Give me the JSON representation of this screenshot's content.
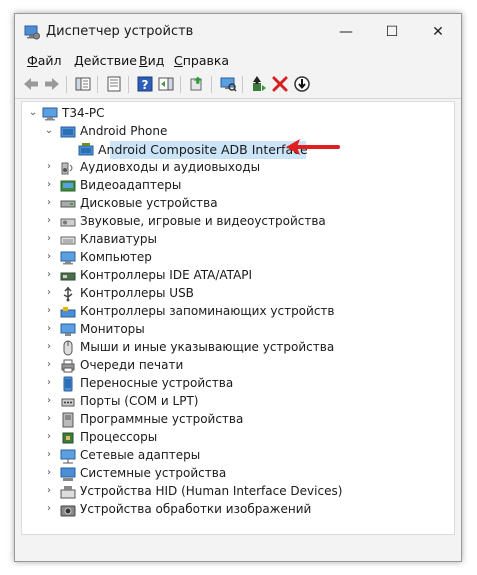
{
  "window": {
    "title": "Диспетчер устройств",
    "controls": {
      "minimize": "—",
      "maximize": "☐",
      "close": "✕"
    }
  },
  "menu": [
    "Файл",
    "Действие",
    "Вид",
    "Справка"
  ],
  "menu_access_keys": [
    "Ф",
    "Д",
    "В",
    "С"
  ],
  "toolbar": {
    "buttons": [
      "back-icon",
      "forward-icon",
      "show-hide-tree-icon",
      "properties-icon",
      "help-icon",
      "action-pane-icon",
      "update-driver-icon",
      "scan-hardware-icon",
      "enable-device-icon",
      "uninstall-icon",
      "disable-device-icon"
    ]
  },
  "tree": {
    "root": "T34-PC",
    "expanded_category": "Android Phone",
    "selected_device": "Android Composite ADB Interface",
    "categories": [
      "Аудиовходы и аудиовыходы",
      "Видеоадаптеры",
      "Дисковые устройства",
      "Звуковые, игровые и видеоустройства",
      "Клавиатуры",
      "Компьютер",
      "Контроллеры IDE ATA/ATAPI",
      "Контроллеры USB",
      "Контроллеры запоминающих устройств",
      "Мониторы",
      "Мыши и иные указывающие устройства",
      "Очереди печати",
      "Переносные устройства",
      "Порты (COM и LPT)",
      "Программные устройства",
      "Процессоры",
      "Сетевые адаптеры",
      "Системные устройства",
      "Устройства HID (Human Interface Devices)",
      "Устройства обработки изображений"
    ],
    "category_icons": [
      "speaker-icon",
      "display-adapter-icon",
      "disk-drive-icon",
      "sound-icon",
      "keyboard-icon",
      "computer-icon",
      "ide-controller-icon",
      "usb-icon",
      "storage-controller-icon",
      "monitor-icon",
      "mouse-icon",
      "printer-icon",
      "portable-device-icon",
      "port-icon",
      "software-device-icon",
      "processor-icon",
      "network-adapter-icon",
      "system-device-icon",
      "hid-icon",
      "imaging-device-icon"
    ]
  },
  "annotation": {
    "arrow_color": "#e02020"
  },
  "colors": {
    "selection": "#cce4f7",
    "accent": "#0067c0"
  }
}
